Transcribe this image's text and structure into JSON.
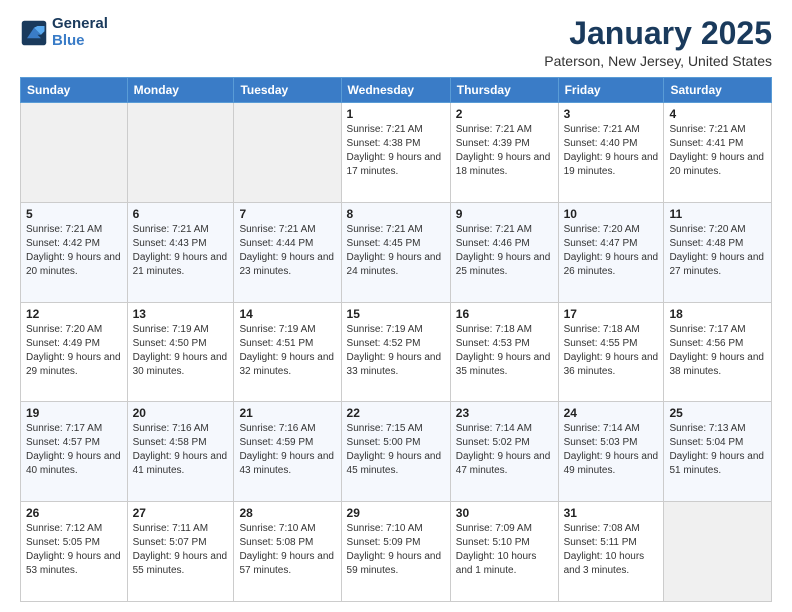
{
  "header": {
    "logo_line1": "General",
    "logo_line2": "Blue",
    "title": "January 2025",
    "location": "Paterson, New Jersey, United States"
  },
  "days_of_week": [
    "Sunday",
    "Monday",
    "Tuesday",
    "Wednesday",
    "Thursday",
    "Friday",
    "Saturday"
  ],
  "weeks": [
    [
      {
        "day": "",
        "sunrise": "",
        "sunset": "",
        "daylight": ""
      },
      {
        "day": "",
        "sunrise": "",
        "sunset": "",
        "daylight": ""
      },
      {
        "day": "",
        "sunrise": "",
        "sunset": "",
        "daylight": ""
      },
      {
        "day": "1",
        "sunrise": "Sunrise: 7:21 AM",
        "sunset": "Sunset: 4:38 PM",
        "daylight": "Daylight: 9 hours and 17 minutes."
      },
      {
        "day": "2",
        "sunrise": "Sunrise: 7:21 AM",
        "sunset": "Sunset: 4:39 PM",
        "daylight": "Daylight: 9 hours and 18 minutes."
      },
      {
        "day": "3",
        "sunrise": "Sunrise: 7:21 AM",
        "sunset": "Sunset: 4:40 PM",
        "daylight": "Daylight: 9 hours and 19 minutes."
      },
      {
        "day": "4",
        "sunrise": "Sunrise: 7:21 AM",
        "sunset": "Sunset: 4:41 PM",
        "daylight": "Daylight: 9 hours and 20 minutes."
      }
    ],
    [
      {
        "day": "5",
        "sunrise": "Sunrise: 7:21 AM",
        "sunset": "Sunset: 4:42 PM",
        "daylight": "Daylight: 9 hours and 20 minutes."
      },
      {
        "day": "6",
        "sunrise": "Sunrise: 7:21 AM",
        "sunset": "Sunset: 4:43 PM",
        "daylight": "Daylight: 9 hours and 21 minutes."
      },
      {
        "day": "7",
        "sunrise": "Sunrise: 7:21 AM",
        "sunset": "Sunset: 4:44 PM",
        "daylight": "Daylight: 9 hours and 23 minutes."
      },
      {
        "day": "8",
        "sunrise": "Sunrise: 7:21 AM",
        "sunset": "Sunset: 4:45 PM",
        "daylight": "Daylight: 9 hours and 24 minutes."
      },
      {
        "day": "9",
        "sunrise": "Sunrise: 7:21 AM",
        "sunset": "Sunset: 4:46 PM",
        "daylight": "Daylight: 9 hours and 25 minutes."
      },
      {
        "day": "10",
        "sunrise": "Sunrise: 7:20 AM",
        "sunset": "Sunset: 4:47 PM",
        "daylight": "Daylight: 9 hours and 26 minutes."
      },
      {
        "day": "11",
        "sunrise": "Sunrise: 7:20 AM",
        "sunset": "Sunset: 4:48 PM",
        "daylight": "Daylight: 9 hours and 27 minutes."
      }
    ],
    [
      {
        "day": "12",
        "sunrise": "Sunrise: 7:20 AM",
        "sunset": "Sunset: 4:49 PM",
        "daylight": "Daylight: 9 hours and 29 minutes."
      },
      {
        "day": "13",
        "sunrise": "Sunrise: 7:19 AM",
        "sunset": "Sunset: 4:50 PM",
        "daylight": "Daylight: 9 hours and 30 minutes."
      },
      {
        "day": "14",
        "sunrise": "Sunrise: 7:19 AM",
        "sunset": "Sunset: 4:51 PM",
        "daylight": "Daylight: 9 hours and 32 minutes."
      },
      {
        "day": "15",
        "sunrise": "Sunrise: 7:19 AM",
        "sunset": "Sunset: 4:52 PM",
        "daylight": "Daylight: 9 hours and 33 minutes."
      },
      {
        "day": "16",
        "sunrise": "Sunrise: 7:18 AM",
        "sunset": "Sunset: 4:53 PM",
        "daylight": "Daylight: 9 hours and 35 minutes."
      },
      {
        "day": "17",
        "sunrise": "Sunrise: 7:18 AM",
        "sunset": "Sunset: 4:55 PM",
        "daylight": "Daylight: 9 hours and 36 minutes."
      },
      {
        "day": "18",
        "sunrise": "Sunrise: 7:17 AM",
        "sunset": "Sunset: 4:56 PM",
        "daylight": "Daylight: 9 hours and 38 minutes."
      }
    ],
    [
      {
        "day": "19",
        "sunrise": "Sunrise: 7:17 AM",
        "sunset": "Sunset: 4:57 PM",
        "daylight": "Daylight: 9 hours and 40 minutes."
      },
      {
        "day": "20",
        "sunrise": "Sunrise: 7:16 AM",
        "sunset": "Sunset: 4:58 PM",
        "daylight": "Daylight: 9 hours and 41 minutes."
      },
      {
        "day": "21",
        "sunrise": "Sunrise: 7:16 AM",
        "sunset": "Sunset: 4:59 PM",
        "daylight": "Daylight: 9 hours and 43 minutes."
      },
      {
        "day": "22",
        "sunrise": "Sunrise: 7:15 AM",
        "sunset": "Sunset: 5:00 PM",
        "daylight": "Daylight: 9 hours and 45 minutes."
      },
      {
        "day": "23",
        "sunrise": "Sunrise: 7:14 AM",
        "sunset": "Sunset: 5:02 PM",
        "daylight": "Daylight: 9 hours and 47 minutes."
      },
      {
        "day": "24",
        "sunrise": "Sunrise: 7:14 AM",
        "sunset": "Sunset: 5:03 PM",
        "daylight": "Daylight: 9 hours and 49 minutes."
      },
      {
        "day": "25",
        "sunrise": "Sunrise: 7:13 AM",
        "sunset": "Sunset: 5:04 PM",
        "daylight": "Daylight: 9 hours and 51 minutes."
      }
    ],
    [
      {
        "day": "26",
        "sunrise": "Sunrise: 7:12 AM",
        "sunset": "Sunset: 5:05 PM",
        "daylight": "Daylight: 9 hours and 53 minutes."
      },
      {
        "day": "27",
        "sunrise": "Sunrise: 7:11 AM",
        "sunset": "Sunset: 5:07 PM",
        "daylight": "Daylight: 9 hours and 55 minutes."
      },
      {
        "day": "28",
        "sunrise": "Sunrise: 7:10 AM",
        "sunset": "Sunset: 5:08 PM",
        "daylight": "Daylight: 9 hours and 57 minutes."
      },
      {
        "day": "29",
        "sunrise": "Sunrise: 7:10 AM",
        "sunset": "Sunset: 5:09 PM",
        "daylight": "Daylight: 9 hours and 59 minutes."
      },
      {
        "day": "30",
        "sunrise": "Sunrise: 7:09 AM",
        "sunset": "Sunset: 5:10 PM",
        "daylight": "Daylight: 10 hours and 1 minute."
      },
      {
        "day": "31",
        "sunrise": "Sunrise: 7:08 AM",
        "sunset": "Sunset: 5:11 PM",
        "daylight": "Daylight: 10 hours and 3 minutes."
      },
      {
        "day": "",
        "sunrise": "",
        "sunset": "",
        "daylight": ""
      }
    ]
  ]
}
